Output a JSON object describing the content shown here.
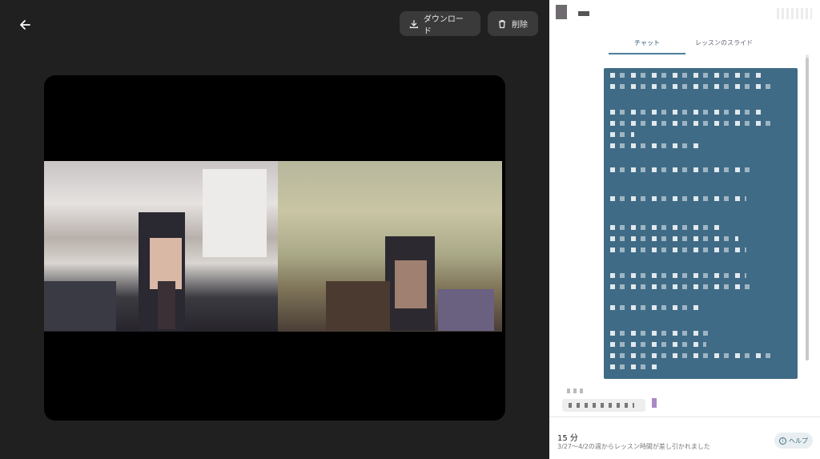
{
  "toolbar": {
    "download_label": "ダウンロード",
    "delete_label": "削除"
  },
  "tabs": [
    {
      "label": "チャット",
      "active": true
    },
    {
      "label": "レッスンのスライド",
      "active": false
    }
  ],
  "footer": {
    "duration": "15 分",
    "note": "3/27〜4/2の週からレッスン時間が差し引かれました",
    "help_label": "ヘルプ"
  },
  "colors": {
    "chat_bubble": "#3f6b86",
    "accent": "#4d7f99",
    "player_bg": "#000000",
    "page_bg": "#202020"
  },
  "icons": {
    "back": "arrow-left-icon",
    "download": "download-icon",
    "delete": "trash-icon",
    "help": "info-icon"
  }
}
